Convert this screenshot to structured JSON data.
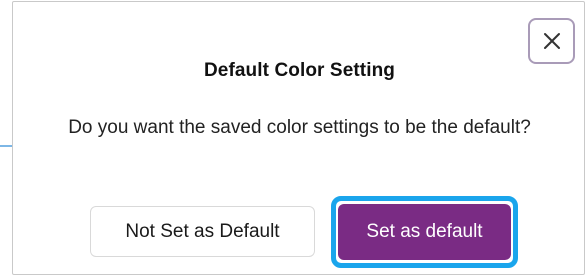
{
  "dialog": {
    "title": "Default Color Setting",
    "message": "Do you want the saved color settings to be the default?",
    "close_icon": "close-icon",
    "buttons": {
      "not_set_label": "Not Set as Default",
      "set_default_label": "Set as default"
    }
  },
  "colors": {
    "primary_button": "#7a2b84",
    "focus_ring": "#1aa5ec",
    "close_border": "#a99bb8"
  }
}
